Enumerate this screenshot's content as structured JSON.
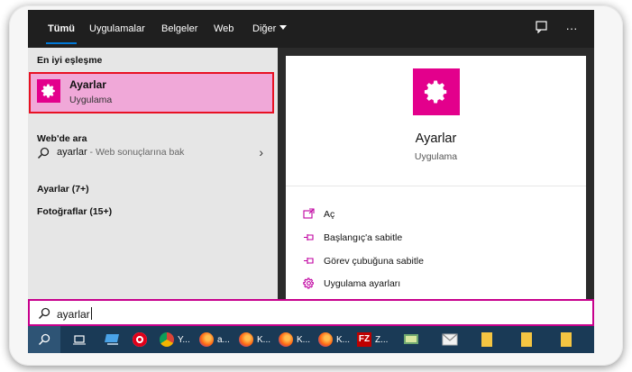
{
  "topbar": {
    "tabs": [
      {
        "label": "Tümü",
        "active": true
      },
      {
        "label": "Uygulamalar"
      },
      {
        "label": "Belgeler"
      },
      {
        "label": "Web"
      },
      {
        "label": "Diğer"
      }
    ],
    "icons": [
      "feedback-icon",
      "more-options-icon"
    ]
  },
  "left": {
    "best_match_heading": "En iyi eşleşme",
    "best_match": {
      "title": "Ayarlar",
      "subtitle": "Uygulama",
      "icon": "gear-icon"
    },
    "web_heading": "Web'de ara",
    "web_query": "ayarlar",
    "web_hint": " - Web sonuçlarına bak",
    "apps_heading": "Ayarlar (7+)",
    "photos_heading": "Fotoğraflar (15+)"
  },
  "right": {
    "title": "Ayarlar",
    "subtitle": "Uygulama",
    "actions": [
      {
        "label": "Aç",
        "icon": "open-icon"
      },
      {
        "label": "Başlangıç'a sabitle",
        "icon": "pin-icon"
      },
      {
        "label": "Görev çubuğuna sabitle",
        "icon": "pin-icon"
      },
      {
        "label": "Uygulama ayarları",
        "icon": "gear-icon"
      }
    ]
  },
  "search": {
    "value": "ayarlar"
  },
  "taskbar": {
    "items": [
      {
        "name": "search",
        "label": ""
      },
      {
        "name": "task-view",
        "label": ""
      },
      {
        "name": "computer",
        "label": ""
      },
      {
        "name": "opera",
        "label": ""
      },
      {
        "name": "chrome",
        "label": "Y..."
      },
      {
        "name": "firefox-1",
        "label": "a..."
      },
      {
        "name": "firefox-2",
        "label": "K..."
      },
      {
        "name": "firefox-3",
        "label": "K..."
      },
      {
        "name": "firefox-4",
        "label": "K..."
      },
      {
        "name": "filezilla",
        "label": "Z..."
      },
      {
        "name": "app",
        "label": ""
      },
      {
        "name": "mail",
        "label": ""
      },
      {
        "name": "file-1",
        "label": ""
      },
      {
        "name": "file-2",
        "label": ""
      },
      {
        "name": "file-3",
        "label": ""
      }
    ]
  },
  "colors": {
    "accent": "#e3008c",
    "highlight": "#f0a8d8",
    "outline": "#e81123",
    "taskbar": "#1a3a56"
  }
}
